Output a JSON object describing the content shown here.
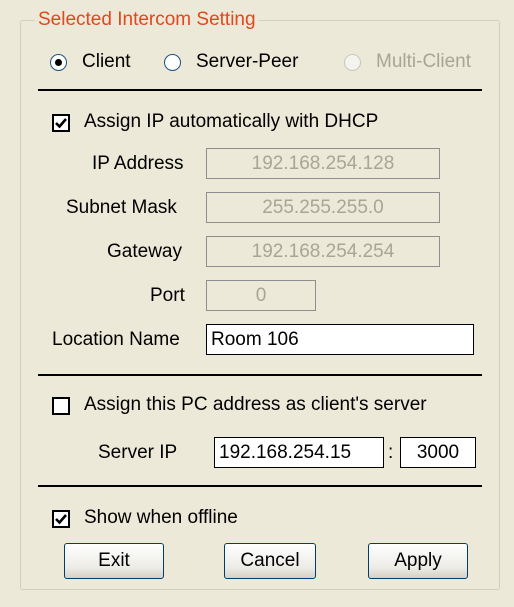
{
  "group_title": "Selected Intercom Setting",
  "mode": {
    "options": [
      {
        "label": "Client",
        "selected": true,
        "enabled": true
      },
      {
        "label": "Server-Peer",
        "selected": false,
        "enabled": true
      },
      {
        "label": "Multi-Client",
        "selected": false,
        "enabled": false
      }
    ]
  },
  "dhcp": {
    "label": "Assign IP automatically with  DHCP",
    "checked": true
  },
  "fields": {
    "ip_address": {
      "label": "IP Address",
      "value": "192.168.254.128"
    },
    "subnet_mask": {
      "label": "Subnet Mask",
      "value": "255.255.255.0"
    },
    "gateway": {
      "label": "Gateway",
      "value": "192.168.254.254"
    },
    "port": {
      "label": "Port",
      "value": "0"
    },
    "location_name": {
      "label": "Location Name",
      "value": "Room 106"
    }
  },
  "assign_server": {
    "label": "Assign this PC address as client's server",
    "checked": false
  },
  "server": {
    "label": "Server IP",
    "ip": "192.168.254.15",
    "separator": ":",
    "port": "3000"
  },
  "show_offline": {
    "label": "Show when offline",
    "checked": true
  },
  "buttons": {
    "exit": "Exit",
    "cancel": "Cancel",
    "apply": "Apply"
  },
  "colors": {
    "legend": "#e2471e",
    "background": "#ece9d8",
    "disabled_text": "#a7a594"
  }
}
